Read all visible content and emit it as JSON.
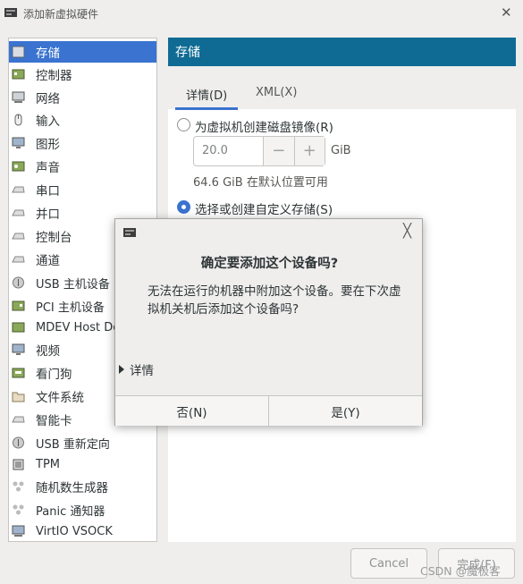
{
  "window": {
    "title": "添加新虚拟硬件",
    "close_glyph": "✕"
  },
  "sidebar": {
    "items": [
      {
        "label": "存储",
        "icon": "storage-icon",
        "selected": true
      },
      {
        "label": "控制器",
        "icon": "controller-icon"
      },
      {
        "label": "网络",
        "icon": "network-icon"
      },
      {
        "label": "输入",
        "icon": "mouse-icon"
      },
      {
        "label": "图形",
        "icon": "monitor-icon"
      },
      {
        "label": "声音",
        "icon": "sound-card-icon"
      },
      {
        "label": "串口",
        "icon": "serial-icon"
      },
      {
        "label": "并口",
        "icon": "parallel-icon"
      },
      {
        "label": "控制台",
        "icon": "console-icon"
      },
      {
        "label": "通道",
        "icon": "channel-icon"
      },
      {
        "label": "USB 主机设备",
        "icon": "usb-icon"
      },
      {
        "label": "PCI 主机设备",
        "icon": "pci-icon"
      },
      {
        "label": "MDEV Host Device",
        "icon": "mdev-icon"
      },
      {
        "label": "视频",
        "icon": "video-icon"
      },
      {
        "label": "看门狗",
        "icon": "watchdog-icon"
      },
      {
        "label": "文件系统",
        "icon": "folder-icon"
      },
      {
        "label": "智能卡",
        "icon": "smartcard-icon"
      },
      {
        "label": "USB 重新定向",
        "icon": "usb-redirect-icon"
      },
      {
        "label": "TPM",
        "icon": "tpm-icon"
      },
      {
        "label": "随机数生成器",
        "icon": "rng-icon"
      },
      {
        "label": "Panic 通知器",
        "icon": "panic-icon"
      },
      {
        "label": "VirtIO VSOCK",
        "icon": "vsock-icon"
      }
    ]
  },
  "panel": {
    "header": "存储",
    "tabs": [
      {
        "label": "详情(D)",
        "active": true
      },
      {
        "label": "XML(X)",
        "active": false
      }
    ],
    "option_create": "为虚拟机创建磁盘镜像(R)",
    "size_value": "20.0",
    "minus": "−",
    "plus": "+",
    "unit": "GiB",
    "available": "64.6 GiB 在默认位置可用",
    "option_custom": "选择或创建自定义存储(S)"
  },
  "footer": {
    "cancel": "Cancel",
    "finish": "完成(F)",
    "watermark": "CSDN @魔极客"
  },
  "dialog": {
    "close_glyph": "╳",
    "title": "确定要添加这个设备吗?",
    "message": "无法在运行的机器中附加这个设备。要在下次虚拟机关机后添加这个设备吗?",
    "details": "详情",
    "no": "否(N)",
    "yes": "是(Y)"
  },
  "colors": {
    "accent": "#3a73d0",
    "header": "#0f6b94"
  }
}
